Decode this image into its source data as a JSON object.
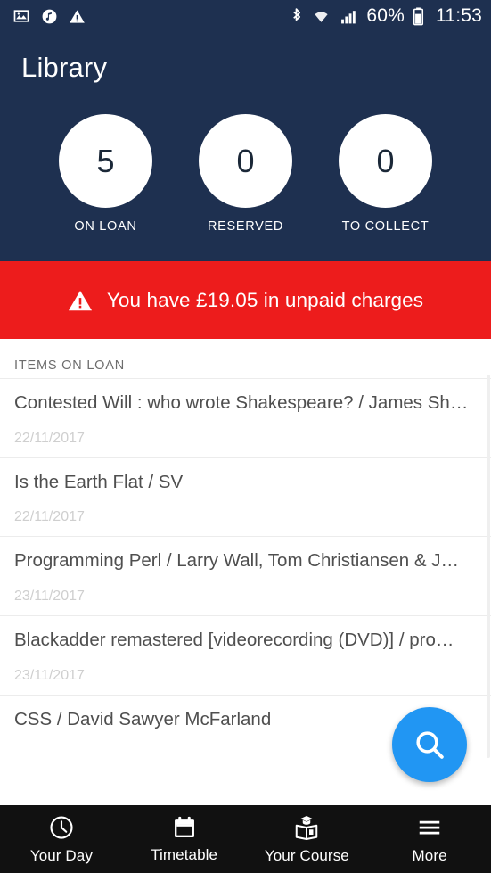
{
  "status_bar": {
    "left_icons": [
      "image-icon",
      "music-note-icon",
      "warning-icon"
    ],
    "bluetooth_icon": "bluetooth-icon",
    "wifi_icon": "wifi-icon",
    "signal_icon": "signal-bars-icon",
    "battery_percent": "60%",
    "battery_icon": "battery-icon",
    "time": "11:53"
  },
  "header": {
    "title": "Library",
    "background_color": "#1e3050",
    "stats": [
      {
        "value": "5",
        "label": "ON LOAN"
      },
      {
        "value": "0",
        "label": "RESERVED"
      },
      {
        "value": "0",
        "label": "TO COLLECT"
      }
    ]
  },
  "alert": {
    "icon": "warning-triangle-icon",
    "text": "You have £19.05 in unpaid charges",
    "background_color": "#ed1c1c"
  },
  "list": {
    "section_label": "ITEMS ON LOAN",
    "items": [
      {
        "title": "Contested Will : who wrote Shakespeare? / James Sh…",
        "date": "22/11/2017"
      },
      {
        "title": "Is the Earth Flat / SV",
        "date": "22/11/2017"
      },
      {
        "title": "Programming Perl / Larry Wall, Tom Christiansen & J…",
        "date": "23/11/2017"
      },
      {
        "title": "Blackadder remastered  [videorecording (DVD)] / pro…",
        "date": "23/11/2017"
      },
      {
        "title": "CSS / David Sawyer McFarland",
        "date": ""
      }
    ]
  },
  "fab": {
    "icon": "search-icon",
    "color": "#2196f3"
  },
  "bottom_nav": {
    "items": [
      {
        "label": "Your Day",
        "icon": "clock-icon"
      },
      {
        "label": "Timetable",
        "icon": "calendar-icon"
      },
      {
        "label": "Your Course",
        "icon": "graduation-book-icon"
      },
      {
        "label": "More",
        "icon": "hamburger-menu-icon"
      }
    ]
  }
}
